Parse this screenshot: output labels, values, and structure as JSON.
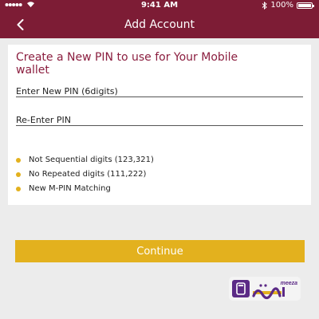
{
  "status_bar": {
    "time": "9:41 AM",
    "battery": "100%",
    "icons": [
      "signal-dots-icon",
      "wifi-icon",
      "bluetooth-icon",
      "battery-icon"
    ]
  },
  "nav": {
    "title": "Add Account",
    "back_icon": "chevron-left-icon"
  },
  "form": {
    "heading": "Create a New PIN to use for Your Mobile wallet",
    "new_pin_placeholder": "Enter New PIN (6digits)",
    "reenter_pin_placeholder": "Re-Enter PIN",
    "rules": [
      "Not Sequential digits (123,321)",
      "No Repeated digits (111,222)",
      "New M-PIN Matching"
    ]
  },
  "continue_label": "Continue",
  "logo": {
    "name": "meeza-logo",
    "text": "meeza",
    "arabic_text": "ميزة"
  },
  "colors": {
    "brand": "#7d1c35",
    "accent": "#e3b11e",
    "heading": "#8b1e3f",
    "background": "#ececec"
  }
}
